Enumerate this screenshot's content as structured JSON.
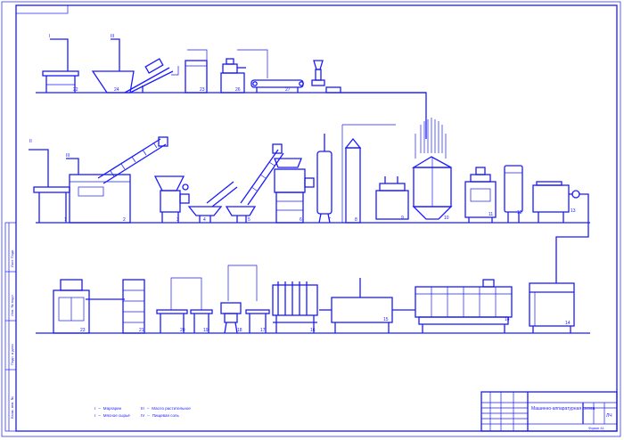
{
  "drawing": {
    "title_block": {
      "title": "Машинно-аппаратурная схема",
      "sheet_id": "ЛЧ",
      "format": "Формат  А1"
    },
    "legend": [
      {
        "code": "I",
        "label": "Маргарин"
      },
      {
        "code": "I",
        "label": "Мясное сырьё"
      },
      {
        "code": "III",
        "label": "Масло растительное"
      },
      {
        "code": "IV",
        "label": "Пищевая соль"
      }
    ],
    "top_callouts": [
      "I",
      "III"
    ],
    "row2_callouts": [
      "II",
      "III"
    ],
    "row1_numbers": [
      "22",
      "24",
      "23",
      "26",
      "27"
    ],
    "row2_numbers": [
      "1",
      "2",
      "3",
      "4",
      "5",
      "6",
      "7",
      "8",
      "9",
      "10",
      "11",
      "12",
      "13"
    ],
    "row3_numbers": [
      "23",
      "21",
      "20",
      "19",
      "18",
      "17",
      "16",
      "15",
      "14"
    ],
    "side_labels": [
      "Лист Подп.",
      "Инв. № подл.",
      "Подп. и дата",
      "Взам. инв. №"
    ],
    "colors": {
      "ink": "#1a1aff",
      "paper": "#ffffff"
    }
  }
}
